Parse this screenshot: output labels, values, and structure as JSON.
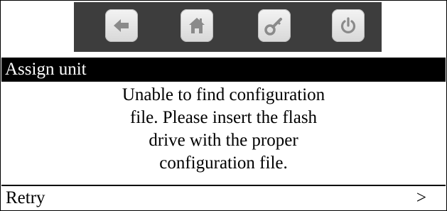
{
  "toolbar": {
    "buttons": [
      {
        "icon": "back-arrow-icon"
      },
      {
        "icon": "home-icon"
      },
      {
        "icon": "key-icon"
      },
      {
        "icon": "power-icon"
      }
    ]
  },
  "header": {
    "title": "Assign unit"
  },
  "message": {
    "lines": [
      "Unable to find configuration",
      "file.  Please insert the flash",
      "drive with the proper",
      "configuration file."
    ]
  },
  "footer": {
    "retry_label": "Retry",
    "arrow": ">"
  },
  "colors": {
    "icon": "#8a8a8a",
    "toolbar_bg": "#3d3d3d",
    "title_bg": "#000000",
    "title_text": "#ffffff"
  }
}
